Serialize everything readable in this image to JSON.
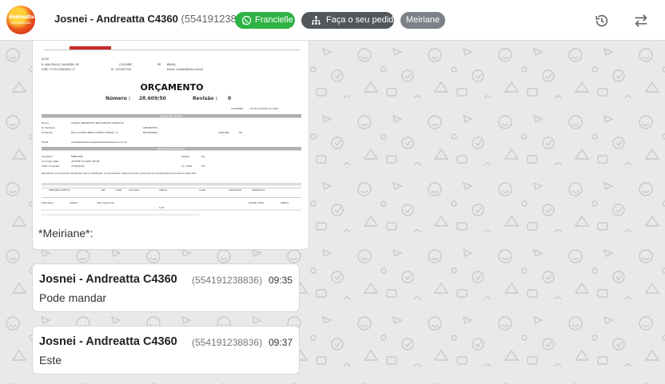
{
  "header": {
    "logo_text": "Andreatta",
    "logo_subtext": "DISTRIBUIDORA",
    "contact_name": "Josnei - Andreatta C4360",
    "contact_phone": "(554191238836)",
    "tags": [
      {
        "label": "Francielle",
        "icon": "whatsapp-icon",
        "color": "#2fb344"
      },
      {
        "label": "Faça o seu pedido",
        "icon": "sitemap-icon",
        "color": "#52575c"
      },
      {
        "label": "Meiriane",
        "icon": "",
        "color": "#7c8187"
      }
    ],
    "actions": [
      {
        "icon": "history-icon"
      },
      {
        "icon": "swap-icon"
      }
    ]
  },
  "document": {
    "title": "ORÇAMENTO",
    "numero_label": "Número :",
    "numero": "28.609/50",
    "revisao_label": "Revisão :",
    "revisao": "0",
    "city": "COLOMBO",
    "date": ", 20 de AGOSTO de 2021",
    "sections": [
      "Dados do Cliente",
      "Dados da Negociação"
    ],
    "client": {
      "name": "CASSIA ANDREATTA IND.COM.DE ADESIVOS",
      "fantasia": "ANDREATTA",
      "address": "RUA CASTRO RIBAS DURÃO LONGO, 11",
      "bairro": "BOQUEIRAO",
      "city": "CURITIBA",
      "uf": "PR",
      "email": "andreattaadesivos@andreattaadesivos.com.br"
    },
    "negotiation": {
      "vendedor": "MEIRIANE",
      "condicao": "28 DFM DA DATA DE NF.",
      "prazo": "15/09/2021",
      "moeda": "R$",
      "frete": "CIF",
      "note": "Atendendo sua prezada solicitação, temos satisfação de apresentar nossa proposta comercial dos produtos/serviços abaixo descritos."
    },
    "item": {
      "produto": "SEMI-BOLO REF PL",
      "un": "UN",
      "qtd": "1.000",
      "unit": "18,7/100",
      "total": "186,81",
      "ipi": "10,00",
      "entrega": "20/09/2021",
      "validade": "24/08/2021"
    },
    "totals": {
      "valor_total_label": "VALOR TOTAL",
      "valor_total": "186,81",
      "total_itens": "186,81",
      "aliq_ipi": "0,25",
      "desconto_label": "Valor Desconto"
    }
  },
  "messages": [
    {
      "sender_prefix": "*Meiriane*:",
      "kind": "image-caption"
    },
    {
      "sender": "Josnei - Andreatta C4360",
      "phone": "(554191238836)",
      "time": "09:35",
      "text": "Pode mandar"
    },
    {
      "sender": "Josnei - Andreatta C4360",
      "phone": "(554191238836)",
      "time": "09:37",
      "text": "Este"
    }
  ]
}
